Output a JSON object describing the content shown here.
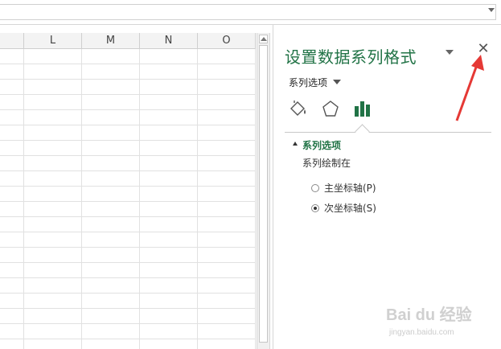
{
  "formula_bar": {},
  "sheet": {
    "columns": [
      "",
      "L",
      "M",
      "N",
      "O"
    ],
    "row_count": 20
  },
  "pane": {
    "title": "设置数据系列格式",
    "options_dropdown": "系列选项",
    "tabs": [
      "fill-line-icon",
      "effects-icon",
      "series-options-icon"
    ],
    "active_tab": "series-options-icon",
    "section_title": "系列选项",
    "plot_label": "系列绘制在",
    "radios": [
      {
        "label": "主坐标轴(P)",
        "checked": false
      },
      {
        "label": "次坐标轴(S)",
        "checked": true
      }
    ]
  },
  "watermark": {
    "brand": "Bai du 经验",
    "url": "jingyan.baidu.com"
  },
  "colors": {
    "accent_green": "#217346",
    "annotation_red": "#e53935"
  }
}
